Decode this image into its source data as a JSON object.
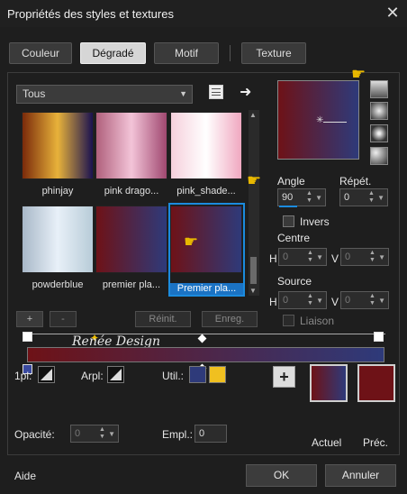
{
  "window": {
    "title": "Propriétés des styles et textures",
    "close_icon": "close-icon"
  },
  "tabs": [
    {
      "label": "Couleur",
      "active": false
    },
    {
      "label": "Dégradé",
      "active": true
    },
    {
      "label": "Motif",
      "active": false
    },
    {
      "label": "Texture",
      "active": false
    }
  ],
  "category": {
    "selected": "Tous"
  },
  "gradients": [
    {
      "label": "phinjay",
      "colors": [
        "#7a2a0a",
        "#e8b23a",
        "#1a1250"
      ]
    },
    {
      "label": "pink drago...",
      "colors": [
        "#b0607c",
        "#f3c4d8",
        "#a04870"
      ]
    },
    {
      "label": "pink_shade...",
      "colors": [
        "#f6d0dc",
        "#ffffff",
        "#f0a8c0"
      ]
    },
    {
      "label": "powderblue",
      "colors": [
        "#a8b8c8",
        "#e8f0f8",
        "#b8ccd8"
      ]
    },
    {
      "label": "premier pla...",
      "colors": [
        "#6e1217",
        "#2e3a7a"
      ]
    },
    {
      "label": "Premier pla...",
      "colors": [
        "#6e1217",
        "#2e3a7a"
      ],
      "selected": true
    }
  ],
  "buttons": {
    "add": "+",
    "remove": "-",
    "reset": "Réinit.",
    "save": "Enreg.",
    "ok": "OK",
    "cancel": "Annuler",
    "help": "Aide"
  },
  "watermark": "Renée Design",
  "gradient_editor": {
    "start_color": "#6e1217",
    "end_color": "#2e3a7a"
  },
  "settings": {
    "angle_label": "Angle",
    "angle_value": "90",
    "repeat_label": "Répét.",
    "repeat_value": "0",
    "invert_label": "Invers",
    "center_label": "Centre",
    "h_label": "H",
    "v_label": "V",
    "center_h": "0",
    "center_v": "0",
    "source_label": "Source",
    "source_h": "0",
    "source_v": "0",
    "link_label": "Liaison"
  },
  "bottom": {
    "plan1_label": "1pl:",
    "arpl_label": "Arpl:",
    "util_label": "Util.:",
    "util_color_a": "#2e3a7a",
    "util_color_b": "#f0c020",
    "opacity_label": "Opacité:",
    "opacity_value": "0",
    "empl_label": "Empl.:",
    "empl_value": "0",
    "current_label": "Actuel",
    "previous_label": "Préc.",
    "previous_color": "#6e1217"
  }
}
